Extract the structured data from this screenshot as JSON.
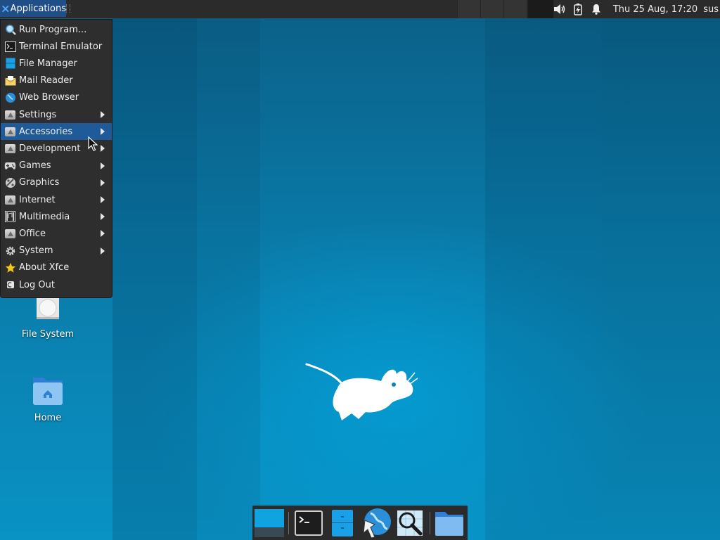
{
  "top_panel": {
    "applications_label": "Applications",
    "clock": "Thu 25 Aug, 17:20",
    "user": "sus",
    "tray_icons": [
      "volume-icon",
      "battery-charging-icon",
      "notification-bell-icon"
    ]
  },
  "menu": {
    "items": [
      {
        "label": "Run Program...",
        "icon": "run-program-icon",
        "submenu": false
      },
      {
        "label": "Terminal Emulator",
        "icon": "terminal-icon",
        "submenu": false
      },
      {
        "label": "File Manager",
        "icon": "file-manager-icon",
        "submenu": false
      },
      {
        "label": "Mail Reader",
        "icon": "mail-icon",
        "submenu": false
      },
      {
        "label": "Web Browser",
        "icon": "web-browser-icon",
        "submenu": false
      },
      {
        "label": "Settings",
        "icon": "settings-icon",
        "submenu": true
      },
      {
        "label": "Accessories",
        "icon": "accessories-icon",
        "submenu": true,
        "highlighted": true
      },
      {
        "label": "Development",
        "icon": "development-icon",
        "submenu": true
      },
      {
        "label": "Games",
        "icon": "gamepad-icon",
        "submenu": true
      },
      {
        "label": "Graphics",
        "icon": "graphics-icon",
        "submenu": true
      },
      {
        "label": "Internet",
        "icon": "internet-icon",
        "submenu": true
      },
      {
        "label": "Multimedia",
        "icon": "multimedia-icon",
        "submenu": true
      },
      {
        "label": "Office",
        "icon": "office-icon",
        "submenu": true
      },
      {
        "label": "System",
        "icon": "gear-icon",
        "submenu": true
      },
      {
        "label": "About Xfce",
        "icon": "star-icon",
        "submenu": false
      },
      {
        "label": "Log Out",
        "icon": "logout-icon",
        "submenu": false
      }
    ]
  },
  "desktop_icons": {
    "file_system": "File System",
    "home": "Home"
  },
  "dock": {
    "items": [
      "show-desktop-icon",
      "terminal-icon",
      "file-manager-icon",
      "web-browser-icon",
      "search-icon",
      "folder-icon"
    ]
  },
  "colors": {
    "panel": "#2b2b2b",
    "highlight": "#1f5a99",
    "apps_button": "#1f4f86",
    "wallpaper": "#0a86b8"
  }
}
